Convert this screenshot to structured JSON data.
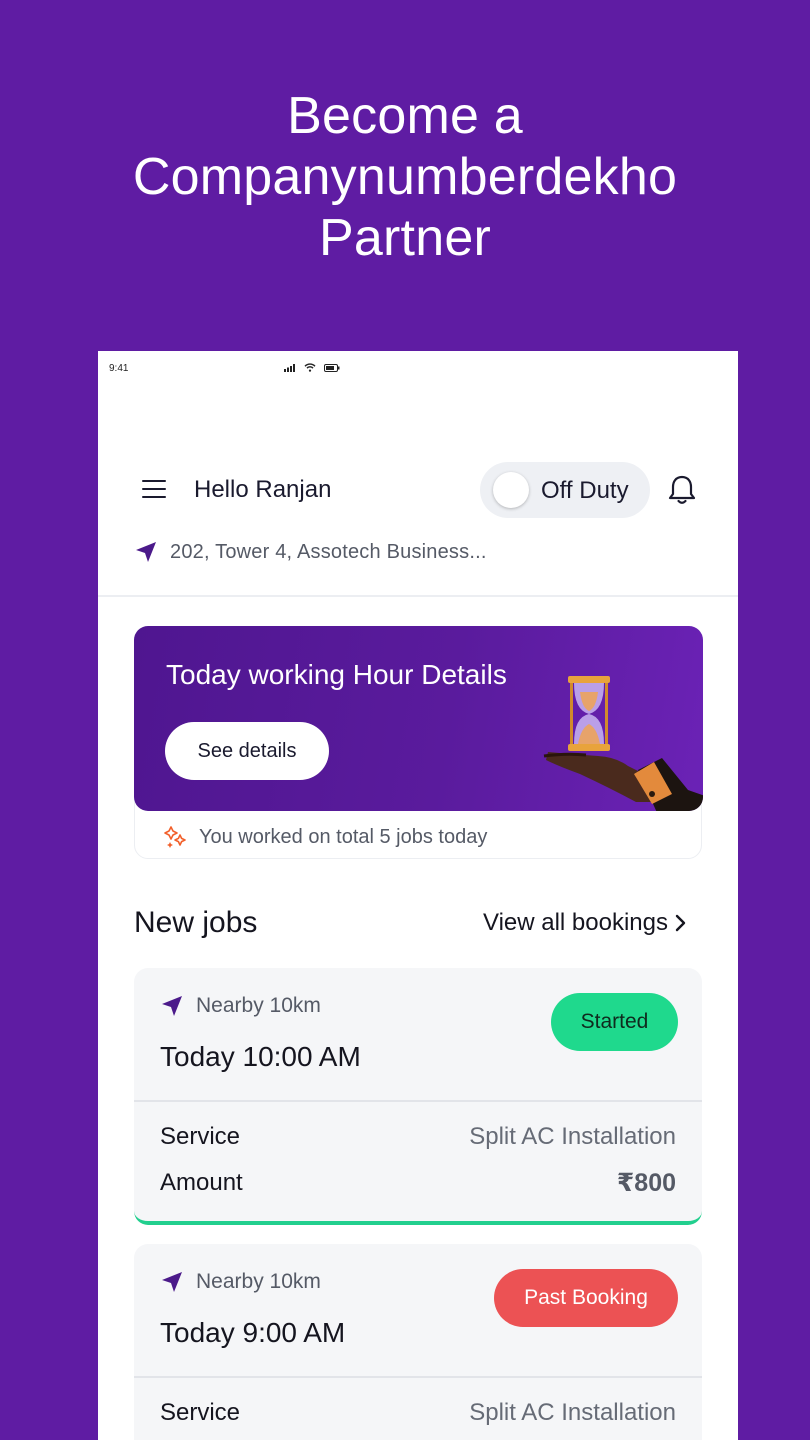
{
  "hero": {
    "line1": "Become a",
    "line2": "Companynumberdekho",
    "line3": "Partner"
  },
  "status_bar": {
    "time": "9:41"
  },
  "header": {
    "greeting": "Hello Ranjan",
    "duty_label": "Off Duty",
    "duty_on": false
  },
  "location": {
    "address": "202, Tower 4, Assotech Business..."
  },
  "promo": {
    "title": "Today working Hour Details",
    "button_label": "See details",
    "summary": "You worked on total 5 jobs today"
  },
  "jobs_section": {
    "title": "New jobs",
    "view_all_label": "View all bookings"
  },
  "jobs": [
    {
      "distance": "Nearby 10km",
      "time": "Today 10:00 AM",
      "status": "Started",
      "service_label": "Service",
      "service_value": "Split AC Installation",
      "amount_label": "Amount",
      "amount_value": "₹800"
    },
    {
      "distance": "Nearby 10km",
      "time": "Today 9:00 AM",
      "status": "Past Booking",
      "service_label": "Service",
      "service_value": "Split AC Installation"
    }
  ],
  "colors": {
    "brand_purple": "#5f1ca3",
    "started_green": "#1fd98d",
    "past_red": "#ec5254",
    "nav_icon": "#4b1a8a"
  },
  "icons": [
    "signal-icon",
    "wifi-icon",
    "battery-icon",
    "menu-icon",
    "bell-icon",
    "navigation-arrow-icon",
    "hourglass-hand-illustration",
    "sparkle-icon",
    "chevron-right-icon"
  ]
}
